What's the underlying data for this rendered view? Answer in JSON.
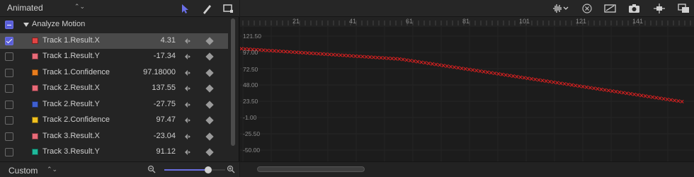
{
  "toolbar_left": {
    "preset": "Animated",
    "tools": [
      "select-arrow-icon",
      "pen-icon",
      "transform-box-icon"
    ]
  },
  "group": {
    "name": "Analyze Motion"
  },
  "rows": [
    {
      "name": "Track 1.Result.X",
      "value": "4.31",
      "color": "#e04444",
      "checked": true
    },
    {
      "name": "Track 1.Result.Y",
      "value": "-17.34",
      "color": "#e86a78",
      "checked": false
    },
    {
      "name": "Track 1.Confidence",
      "value": "97.18000",
      "color": "#e87d1e",
      "checked": false
    },
    {
      "name": "Track 2.Result.X",
      "value": "137.55",
      "color": "#e86a78",
      "checked": false
    },
    {
      "name": "Track 2.Result.Y",
      "value": "-27.75",
      "color": "#3f5fd0",
      "checked": false
    },
    {
      "name": "Track 2.Confidence",
      "value": "97.47",
      "color": "#f0c020",
      "checked": false
    },
    {
      "name": "Track 3.Result.X",
      "value": "-23.04",
      "color": "#e86a78",
      "checked": false
    },
    {
      "name": "Track 3.Result.Y",
      "value": "91.12",
      "color": "#1fb89a",
      "checked": false
    }
  ],
  "footer_left": {
    "view": "Custom",
    "zoom": 0.72
  },
  "ruler_labels": [
    "21",
    "41",
    "61",
    "81",
    "101",
    "121",
    "141"
  ],
  "y_labels": [
    "121.50",
    "97.00",
    "72.50",
    "48.00",
    "23.50",
    "-1.00",
    "-25.50",
    "-50.00"
  ],
  "curve": {
    "color": "#d42020",
    "start_value": 102.5,
    "mid_value": 87.0,
    "end_value": 23.0
  }
}
